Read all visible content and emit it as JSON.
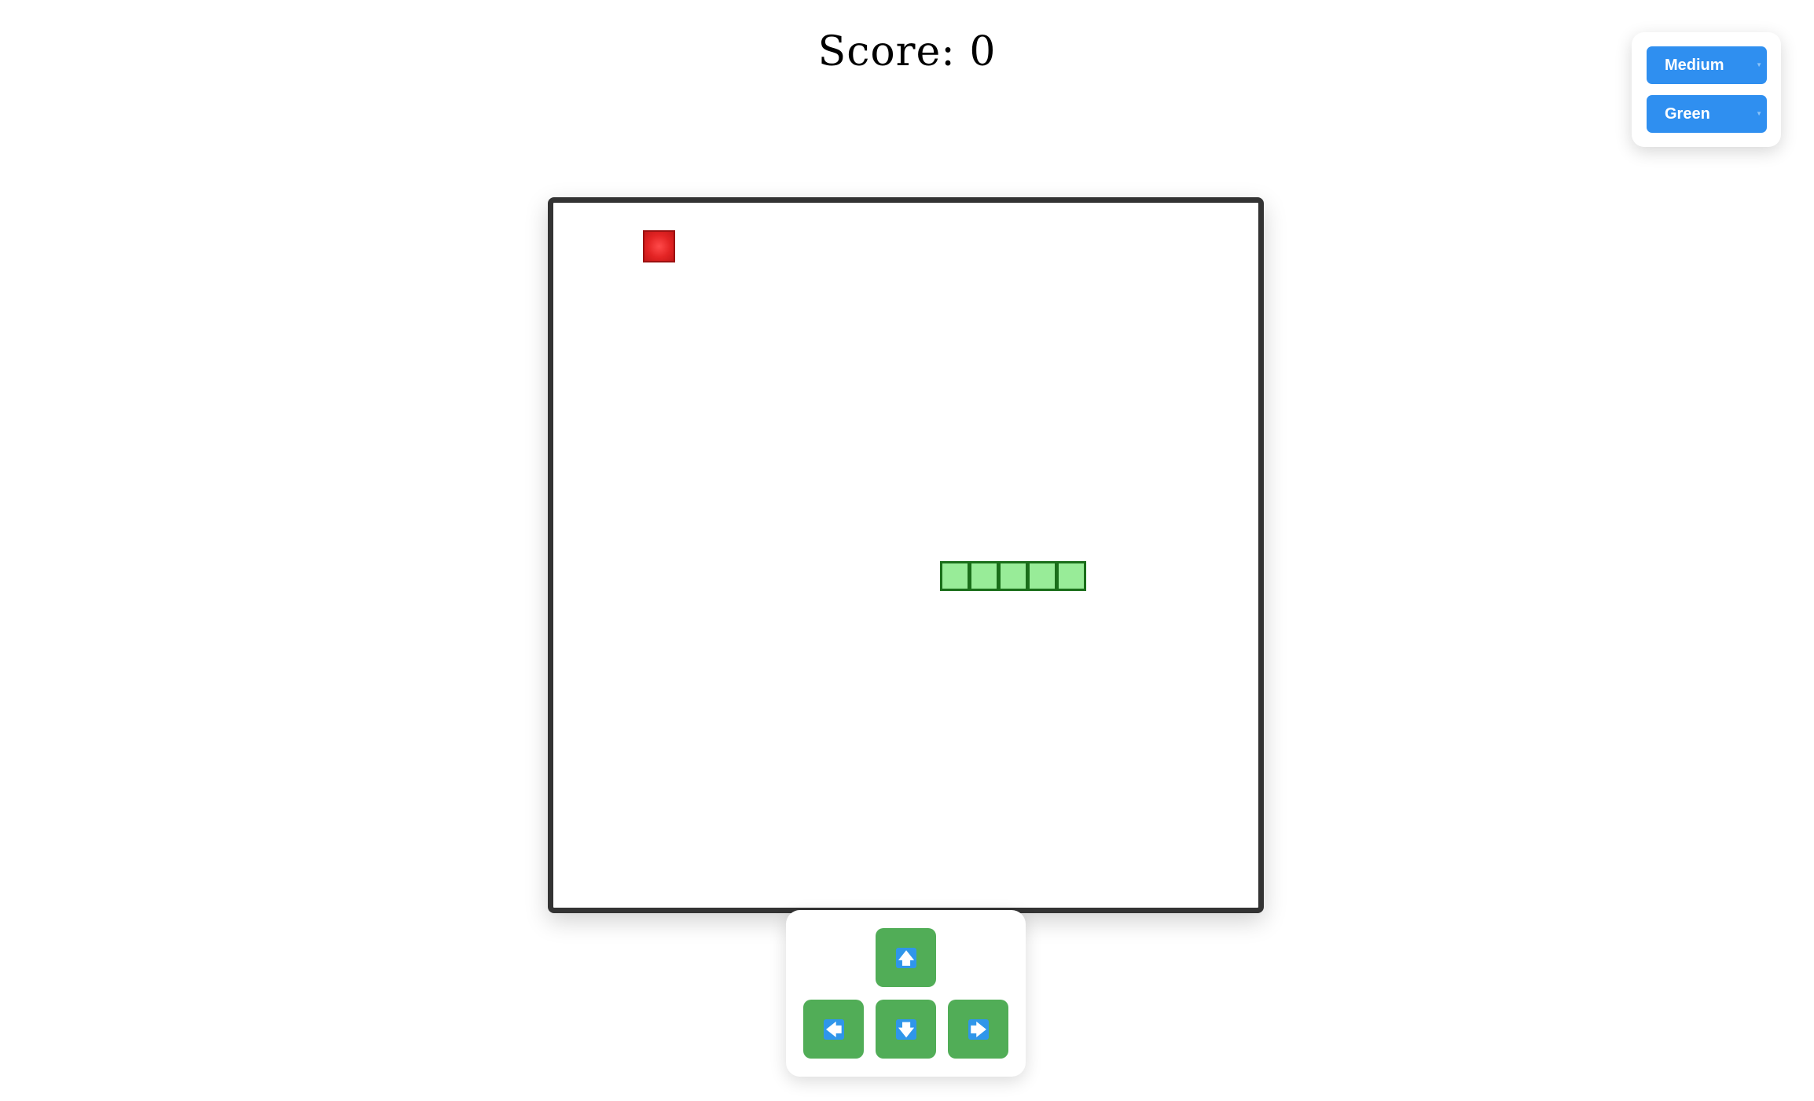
{
  "score": {
    "label": "Score:",
    "value": "0"
  },
  "settings": {
    "difficulty": {
      "selected": "Medium",
      "icon": "chevron-down-icon"
    },
    "snake_color": {
      "selected": "Green",
      "icon": "chevron-down-icon"
    }
  },
  "board": {
    "grid": {
      "columns": 24,
      "rows": 24
    },
    "food": {
      "cell": [
        3,
        1
      ],
      "color": "#e32424"
    },
    "snake": {
      "color": "#98ec98",
      "outline": "#1a6e1a",
      "length": 5,
      "cells": [
        [
          13,
          12
        ],
        [
          14,
          12
        ],
        [
          15,
          12
        ],
        [
          16,
          12
        ],
        [
          17,
          12
        ]
      ]
    }
  },
  "controls": {
    "up": {
      "glyph": "🡅",
      "icon": "arrow-up-icon"
    },
    "left": {
      "glyph": "🡄",
      "icon": "arrow-left-icon"
    },
    "down": {
      "glyph": "🡇",
      "icon": "arrow-down-icon"
    },
    "right": {
      "glyph": "🡆",
      "icon": "arrow-right-icon"
    },
    "button_color": "#51ad57",
    "key_color": "#2f96ea"
  }
}
